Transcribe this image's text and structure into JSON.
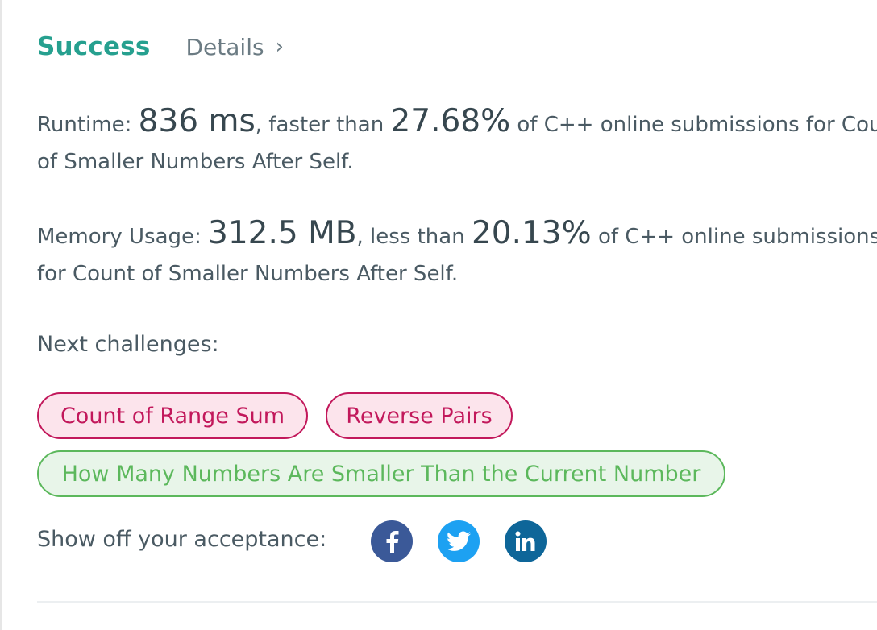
{
  "result": {
    "status": "Success",
    "details_label": "Details",
    "details_chevron": "›"
  },
  "runtime": {
    "label": "Runtime: ",
    "value": "836 ms",
    "comparison": ", faster than ",
    "percent": "27.68%",
    "suffix_line1": " of C++ online submissions for Count",
    "suffix_line2": "of Smaller Numbers After Self."
  },
  "memory": {
    "label": "Memory Usage: ",
    "value": "312.5 MB",
    "comparison": ", less than ",
    "percent": "20.13%",
    "suffix_line1": " of C++ online submissions",
    "suffix_line2": "for Count of Smaller Numbers After Self."
  },
  "next": {
    "label": "Next challenges:",
    "challenges": [
      {
        "title": "Count of Range Sum",
        "difficulty": "hard"
      },
      {
        "title": "Reverse Pairs",
        "difficulty": "hard"
      },
      {
        "title": "How Many Numbers Are Smaller Than the Current Number",
        "difficulty": "easy"
      }
    ]
  },
  "share": {
    "label": "Show off your acceptance:",
    "icons": [
      "facebook-icon",
      "twitter-icon",
      "linkedin-icon"
    ]
  },
  "colors": {
    "success": "#26a08f",
    "hard": "#c2185b",
    "easy": "#5cb85c",
    "facebook": "#3b5998",
    "twitter": "#1da1f2",
    "linkedin": "#0e6699"
  }
}
